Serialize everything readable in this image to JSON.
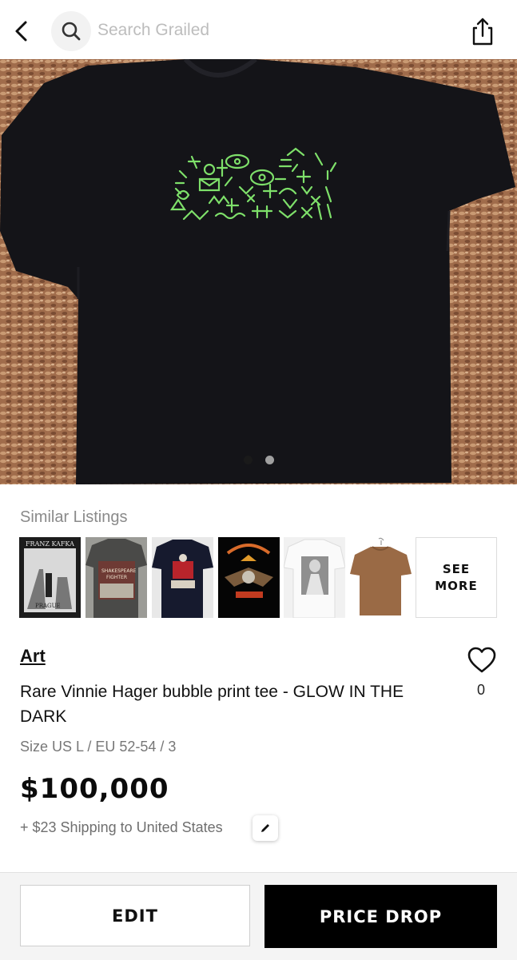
{
  "header": {
    "search_placeholder": "Search Grailed",
    "back_icon": "chevron-left-icon",
    "search_icon": "search-icon",
    "share_icon": "share-icon"
  },
  "gallery": {
    "image_count": 2,
    "active_index": 0
  },
  "similar": {
    "title": "Similar Listings",
    "see_more": "SEE MORE",
    "thumbnails": [
      {
        "text_top": "FRANZ KAFKA",
        "text_bottom": "PRAGUE"
      },
      {
        "text_top": "SHAKESPEARE",
        "text_bottom": "FIGHTER"
      },
      {
        "text_top": "",
        "text_bottom": ""
      },
      {
        "text_top": "",
        "text_bottom": ""
      },
      {
        "text_top": "",
        "text_bottom": ""
      },
      {
        "text_top": "",
        "text_bottom": ""
      }
    ]
  },
  "listing": {
    "category": "Art",
    "title": "Rare Vinnie Hager bubble print tee - GLOW IN THE DARK",
    "size": "Size US L / EU 52-54 / 3",
    "price": "$100,000",
    "shipping": "+ $23 Shipping to United States",
    "likes": "0"
  },
  "actions": {
    "edit": "EDIT",
    "price_drop": "PRICE DROP"
  },
  "colors": {
    "accent": "#000000",
    "print_green": "#7ee06a",
    "shirt": "#141418"
  }
}
